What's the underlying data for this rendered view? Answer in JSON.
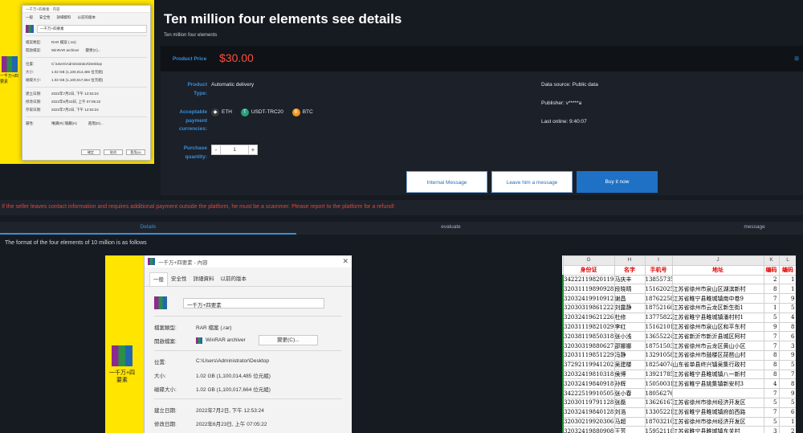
{
  "thumbnail": {
    "icon_label": "一千万+四要素",
    "window_title": "一千万+四要素 - 内容",
    "tabs": [
      "一般",
      "安全性",
      "詳細資料",
      "以前的版本"
    ],
    "file_name": "一千万+四要素",
    "rows": [
      {
        "k": "檔案類型:",
        "v": "RAR 檔案 (.rar)"
      },
      {
        "k": "開啟檔案:",
        "v": "WinRAR archiver",
        "extra": "變更(C)..."
      },
      {
        "k": "位置:",
        "v": "C:\\Users\\Administrator\\Desktop"
      },
      {
        "k": "大小:",
        "v": "1.02 GB (1,100,014,485 位元組)"
      },
      {
        "k": "磁碟大小:",
        "v": "1.02 GB (1,100,017,664 位元組)"
      },
      {
        "k": "建立日期:",
        "v": "2022年7月2日, 下午 12:53:24"
      },
      {
        "k": "修改日期:",
        "v": "2022年6月23日, 上午 07:05:22"
      },
      {
        "k": "存取日期:",
        "v": "2022年7月2日, 下午 12:53:24"
      },
      {
        "k": "屬性:",
        "v": "唯讀(R)  隱藏(H)",
        "extra": "進階(D)..."
      }
    ],
    "buttons": [
      "確定",
      "取消",
      "套用(A)"
    ]
  },
  "product": {
    "title": "Ten million four elements see details",
    "subtitle": "Ten million four elements",
    "price_label": "Product Price",
    "price": "$30.00",
    "type_label": "Product Type:",
    "type_value": "Automatic delivery",
    "payment_label": "Acceptable payment currencies:",
    "currencies": [
      {
        "name": "ETH",
        "icon": "eth-icon",
        "color": "#3c3c3d",
        "glyph": "◆"
      },
      {
        "name": "USDT-TRC20",
        "icon": "usdt-icon",
        "color": "#26a17b",
        "glyph": "T"
      },
      {
        "name": "BTC",
        "icon": "btc-icon",
        "color": "#f7931a",
        "glyph": "B"
      }
    ],
    "quantity_label": "Purchase quantity:",
    "quantity": "1",
    "minus": "-",
    "plus": "+",
    "data_source": "Data source: Public data",
    "publisher": "Publisher: v*****a",
    "last_online": "Last online: 9:40:07",
    "buttons": {
      "internal": "Internal Message",
      "leave": "Leave him a message",
      "buy": "Buy it now"
    }
  },
  "warning": "If the seller leaves contact information and requires additional payment outside the platform, he must be a scammer. Please report to the platform for a refund!",
  "tabs": [
    "Details",
    "evaluate",
    "message"
  ],
  "description": "The format of the four elements of 10 million is as follows",
  "screenshot1": {
    "icon_label": "一千万+四要素",
    "window_title": "一千万+四要素 - 內容",
    "close": "✕",
    "tabs": [
      "一般",
      "安全性",
      "詳細資料",
      "以前的版本"
    ],
    "file_name": "一千万+四要素",
    "type_k": "檔案類型:",
    "type_v": "RAR 檔案 (.rar)",
    "open_k": "開啟檔案:",
    "open_v": "WinRAR archiver",
    "change": "變更(C)...",
    "loc_k": "位置:",
    "loc_v": "C:\\Users\\Administrator\\Desktop",
    "size_k": "大小:",
    "size_v": "1.02 GB (1,100,014,485 位元組)",
    "disk_k": "磁碟大小:",
    "disk_v": "1.02 GB (1,100,017,664 位元組)",
    "created_k": "建立日期:",
    "created_v": "2022年7月2日, 下午 12:53:24",
    "modified_k": "修改日期:",
    "modified_v": "2022年6月23日, 上午 07:05:22"
  },
  "excel": {
    "columns": [
      "G",
      "H",
      "I",
      "J",
      "K",
      "L"
    ],
    "headers": [
      "身份证",
      "名字",
      "手机号",
      "地址",
      "编码",
      "编码"
    ],
    "rows": [
      [
        "342221198201191",
        "马庆丰",
        "13855735095",
        "",
        "2",
        "1"
      ],
      [
        "320311198909281",
        "段晓晴",
        "15162025",
        "江苏省徐州市泉山区湖滨新村",
        "8",
        "1"
      ],
      [
        "320324199109121",
        "谢昌",
        "18762258",
        "江苏省睢宁县睢城镇南中卷9",
        "7",
        "9"
      ],
      [
        "320303198612221",
        "刘露静",
        "18752160",
        "江苏省徐州市云龙区新生街1",
        "1",
        "5"
      ],
      [
        "320324196212261",
        "杜修",
        "13775822",
        "江苏省睢宁县睢城镇潘村村1",
        "5",
        "4"
      ],
      [
        "320311198210291",
        "李红",
        "15162101",
        "江苏省徐州市泉山区和平东村",
        "9",
        "8"
      ],
      [
        "320381198503181",
        "张小浅",
        "13655224",
        "江苏省新沂市新沂县城区阿村",
        "7",
        "6"
      ],
      [
        "320303198806271",
        "邵娜娜",
        "18751503",
        "江苏省徐州市云龙区黄山小区",
        "7",
        "3"
      ],
      [
        "320311198512291",
        "冯静",
        "13291058",
        "江苏省徐州市鼓楼区琵琶山村",
        "8",
        "9"
      ],
      [
        "372921199412021",
        "吴建楼",
        "18254074",
        "山东省单县终兴镇吴集行政村",
        "8",
        "5"
      ],
      [
        "320324198103181",
        "侯博",
        "13921785",
        "江苏省睢宁县睢城镇八一新村",
        "8",
        "7"
      ],
      [
        "320324198409181",
        "孙辉",
        "15050031",
        "江苏省睢宁县姚集镇新安村3",
        "4",
        "8"
      ],
      [
        "342225199105051",
        "张小春",
        "18056276587",
        "",
        "7",
        "9"
      ],
      [
        "320301197911281",
        "张磊",
        "13626167",
        "江苏省徐州市徐州经济开发区",
        "5",
        "5"
      ],
      [
        "320324198401281",
        "刘浩",
        "13305221",
        "江苏省睢宁县睢城镇府前西路",
        "7",
        "6"
      ],
      [
        "320302199203061",
        "马超",
        "18703210",
        "江苏省徐州市徐州经济开发区",
        "5",
        "1"
      ],
      [
        "320324198809081",
        "王芳",
        "15952118",
        "江苏省睢宁县睢城镇东关村",
        "3",
        "2"
      ]
    ]
  }
}
